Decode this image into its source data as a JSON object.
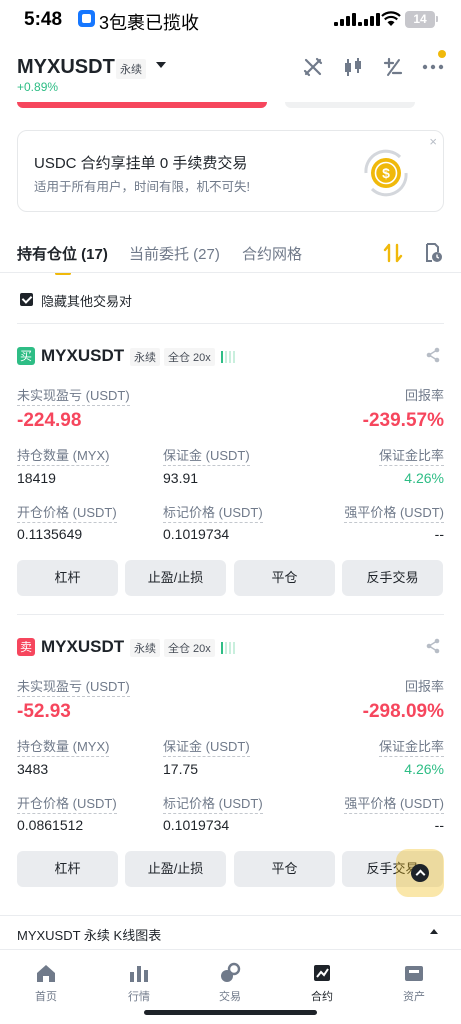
{
  "status_bar": {
    "time": "5:48",
    "notification": "3包裹已揽收",
    "battery": "14"
  },
  "header": {
    "pair": "MYXUSDT",
    "contract_type": "永续",
    "change": "+0.89%",
    "icons": [
      "crossed-swords-icon",
      "candlestick-icon",
      "plus-minus-icon",
      "more-icon"
    ]
  },
  "banner": {
    "title": "USDC 合约享挂单 0 手续费交易",
    "subtitle": "适用于所有用户，时间有限，机不可失!",
    "close": "×"
  },
  "tabs": [
    {
      "label": "持有仓位 (17)",
      "active": true
    },
    {
      "label": "当前委托 (27)",
      "active": false
    },
    {
      "label": "合约网格",
      "active": false
    }
  ],
  "hide_other_pairs": {
    "label": "隐藏其他交易对",
    "checked": true
  },
  "positions": [
    {
      "side": "买",
      "side_color": "#2ebd85",
      "symbol": "MYXUSDT",
      "contract_type": "永续",
      "margin_mode": "全仓 20x",
      "unrealized_pnl_label": "未实现盈亏 (USDT)",
      "unrealized_pnl": "-224.98",
      "roe_label": "回报率",
      "roe": "-239.57%",
      "size_label": "持仓数量 (MYX)",
      "size": "18419",
      "margin_label": "保证金 (USDT)",
      "margin": "93.91",
      "margin_ratio_label": "保证金比率",
      "margin_ratio": "4.26%",
      "entry_label": "开仓价格 (USDT)",
      "entry_price": "0.1135649",
      "mark_label": "标记价格 (USDT)",
      "mark_price": "0.1019734",
      "liq_label": "强平价格 (USDT)",
      "liq_price": "--",
      "buttons": [
        "杠杆",
        "止盈/止损",
        "平仓",
        "反手交易"
      ]
    },
    {
      "side": "卖",
      "side_color": "#f6465d",
      "symbol": "MYXUSDT",
      "contract_type": "永续",
      "margin_mode": "全仓 20x",
      "unrealized_pnl_label": "未实现盈亏 (USDT)",
      "unrealized_pnl": "-52.93",
      "roe_label": "回报率",
      "roe": "-298.09%",
      "size_label": "持仓数量 (MYX)",
      "size": "3483",
      "margin_label": "保证金 (USDT)",
      "margin": "17.75",
      "margin_ratio_label": "保证金比率",
      "margin_ratio": "4.26%",
      "entry_label": "开仓价格 (USDT)",
      "entry_price": "0.0861512",
      "mark_label": "标记价格 (USDT)",
      "mark_price": "0.1019734",
      "liq_label": "强平价格 (USDT)",
      "liq_price": "--",
      "buttons": [
        "杠杆",
        "止盈/止损",
        "平仓",
        "反手交易"
      ]
    }
  ],
  "kline_bar": {
    "label": "MYXUSDT 永续 K线图表"
  },
  "bottom_nav": [
    {
      "label": "首页",
      "icon": "home-icon",
      "active": false
    },
    {
      "label": "行情",
      "icon": "markets-icon",
      "active": false
    },
    {
      "label": "交易",
      "icon": "trade-icon",
      "active": false
    },
    {
      "label": "合约",
      "icon": "futures-icon",
      "active": true
    },
    {
      "label": "资产",
      "icon": "wallet-icon",
      "active": false
    }
  ]
}
